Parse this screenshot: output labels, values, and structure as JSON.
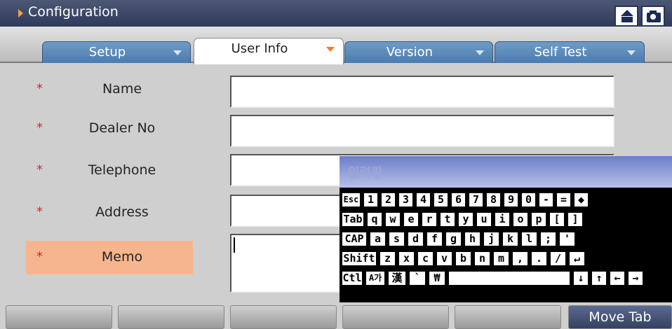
{
  "title": "Configuration",
  "titlebar_icons": [
    "home-icon",
    "camera-icon"
  ],
  "tabs": [
    {
      "label": "Setup",
      "active": false
    },
    {
      "label": "User Info",
      "active": true
    },
    {
      "label": "Version",
      "active": false
    },
    {
      "label": "Self Test",
      "active": false
    }
  ],
  "form": {
    "required_marker": "*",
    "fields": [
      {
        "label": "Name",
        "value": ""
      },
      {
        "label": "Dealer No",
        "value": ""
      },
      {
        "label": "Telephone",
        "value": ""
      },
      {
        "label": "Address",
        "value": ""
      },
      {
        "label": "Memo",
        "value": "",
        "focused": true
      }
    ]
  },
  "keyboard": {
    "title": "입력판",
    "rows": [
      [
        "Esc",
        "1",
        "2",
        "3",
        "4",
        "5",
        "6",
        "7",
        "8",
        "9",
        "0",
        "-",
        "=",
        "◆"
      ],
      [
        "Tab",
        "q",
        "w",
        "e",
        "r",
        "t",
        "y",
        "u",
        "i",
        "o",
        "p",
        "[",
        "]"
      ],
      [
        "CAP",
        "a",
        "s",
        "d",
        "f",
        "g",
        "h",
        "j",
        "k",
        "l",
        ";",
        "'"
      ],
      [
        "Shift",
        "z",
        "x",
        "c",
        "v",
        "b",
        "n",
        "m",
        ",",
        ".",
        "/",
        "↵"
      ],
      [
        "Ctl",
        "A가",
        "漢",
        "`",
        "₩",
        "",
        "↓",
        "↑",
        "←",
        "→"
      ]
    ]
  },
  "bottom_buttons": [
    "",
    "",
    "",
    "",
    "",
    "Move Tab"
  ],
  "colors": {
    "title_bg": "#3b4668",
    "tab_blue": "#5b8bbf",
    "highlight": "#f6b58f",
    "required": "#e0242a",
    "move_tab_bg": "#3f4b6e"
  }
}
